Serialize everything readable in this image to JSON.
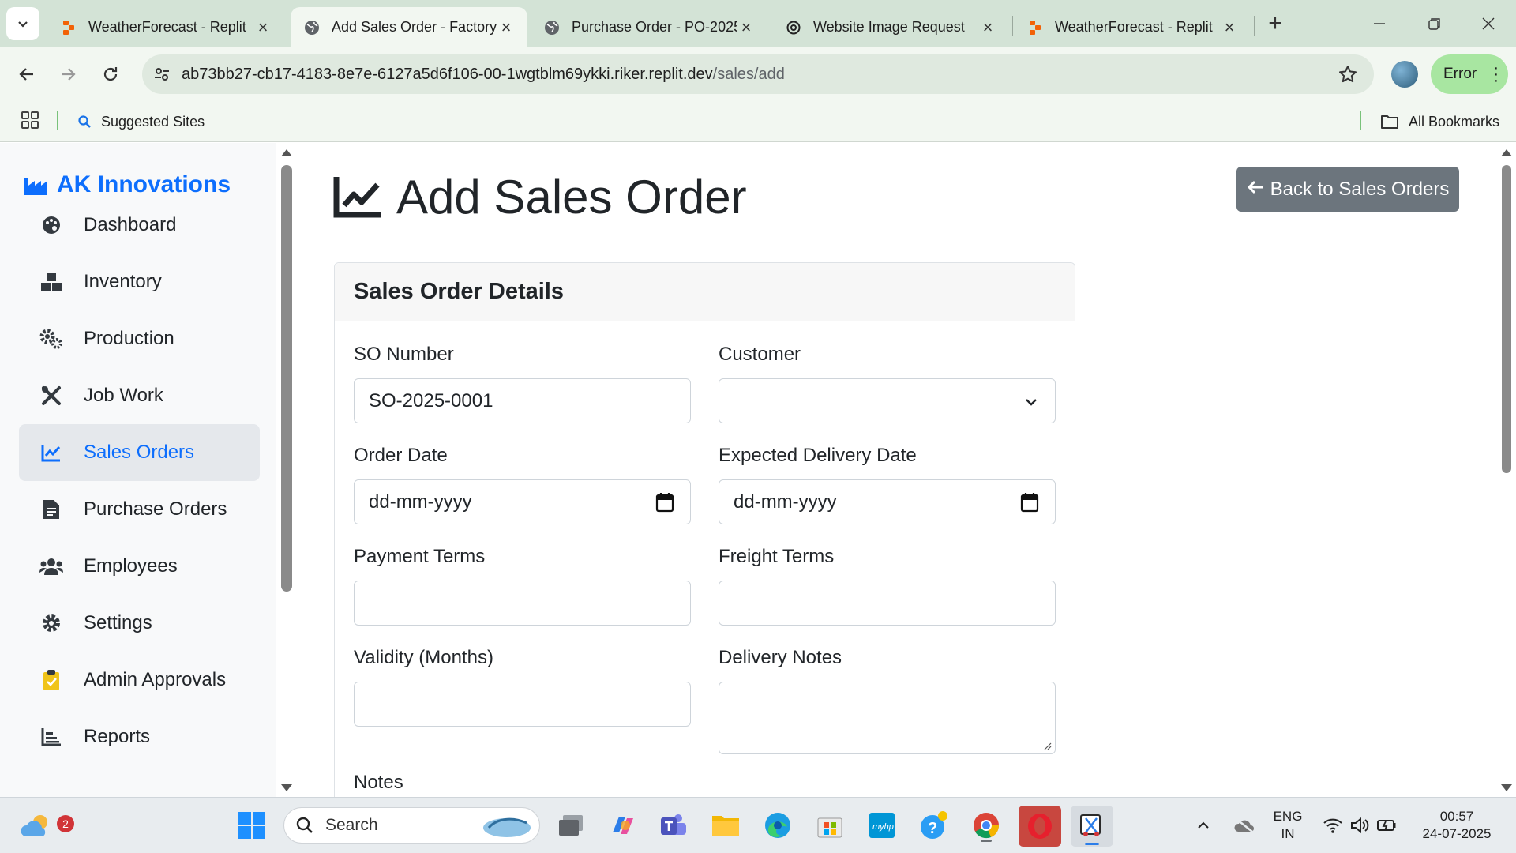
{
  "browser": {
    "tabs": [
      {
        "title": "WeatherForecast - Replit",
        "icon": "replit-icon",
        "active": false
      },
      {
        "title": "Add Sales Order - Factory",
        "icon": "globe-icon",
        "active": true
      },
      {
        "title": "Purchase Order - PO-2025",
        "icon": "globe-icon",
        "active": false
      },
      {
        "title": "Website Image Request",
        "icon": "openai-icon",
        "active": false
      },
      {
        "title": "WeatherForecast - Replit",
        "icon": "replit-icon",
        "active": false
      }
    ],
    "url_host": "ab73bb27-cb17-4183-8e7e-6127a5d6f106-00-1wgtblm69ykki.riker.replit.dev",
    "url_path": "/sales/add",
    "error_label": "Error",
    "bookmarks": {
      "suggested": "Suggested Sites",
      "all": "All Bookmarks"
    }
  },
  "sidebar": {
    "brand": "AK Innovations",
    "items": [
      {
        "label": "Dashboard",
        "icon": "palette-icon"
      },
      {
        "label": "Inventory",
        "icon": "boxes-icon"
      },
      {
        "label": "Production",
        "icon": "cogs-icon"
      },
      {
        "label": "Job Work",
        "icon": "tools-icon"
      },
      {
        "label": "Sales Orders",
        "icon": "chart-line-icon",
        "active": true
      },
      {
        "label": "Purchase Orders",
        "icon": "file-invoice-icon"
      },
      {
        "label": "Employees",
        "icon": "users-icon"
      },
      {
        "label": "Settings",
        "icon": "gear-icon"
      },
      {
        "label": "Admin Approvals",
        "icon": "clipboard-check-icon"
      },
      {
        "label": "Reports",
        "icon": "chart-bar-icon"
      }
    ]
  },
  "main": {
    "title": "Add Sales Order",
    "back_button": "Back to Sales Orders",
    "card_title": "Sales Order Details",
    "fields": {
      "so_number": {
        "label": "SO Number",
        "value": "SO-2025-0001"
      },
      "customer": {
        "label": "Customer",
        "value": ""
      },
      "order_date": {
        "label": "Order Date",
        "placeholder": "dd-mm-yyyy"
      },
      "delivery_date": {
        "label": "Expected Delivery Date",
        "placeholder": "dd-mm-yyyy"
      },
      "payment_terms": {
        "label": "Payment Terms",
        "value": ""
      },
      "freight_terms": {
        "label": "Freight Terms",
        "value": ""
      },
      "validity": {
        "label": "Validity (Months)",
        "value": ""
      },
      "delivery_notes": {
        "label": "Delivery Notes",
        "value": ""
      },
      "notes": {
        "label": "Notes"
      }
    }
  },
  "taskbar": {
    "search_placeholder": "Search",
    "weather_badge": "2",
    "lang_line1": "ENG",
    "lang_line2": "IN",
    "time": "00:57",
    "date": "24-07-2025"
  },
  "colors": {
    "brand": "#0d6efd",
    "tabstrip": "#d3e3d6",
    "toolbar": "#f2f7f1",
    "back_button": "#6c757d",
    "error_pill": "#a8e6a1"
  }
}
